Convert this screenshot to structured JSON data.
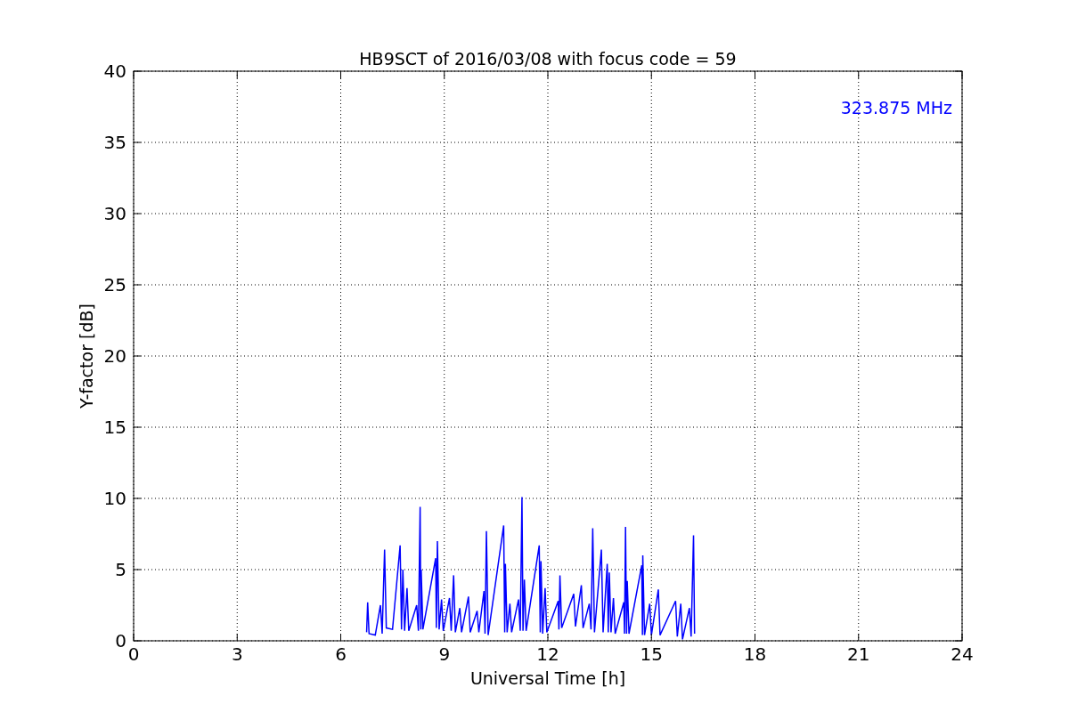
{
  "chart_data": {
    "type": "line",
    "title": "HB9SCT of 2016/03/08 with focus code = 59",
    "xlabel": "Universal Time [h]",
    "ylabel": "Y-factor [dB]",
    "x": [
      6.75,
      6.78,
      6.82,
      7.0,
      7.15,
      7.2,
      7.27,
      7.32,
      7.5,
      7.72,
      7.76,
      7.8,
      7.85,
      7.92,
      7.97,
      8.2,
      8.25,
      8.3,
      8.32,
      8.33,
      8.38,
      8.75,
      8.77,
      8.8,
      8.85,
      8.92,
      8.97,
      9.15,
      9.2,
      9.27,
      9.32,
      9.45,
      9.5,
      9.7,
      9.75,
      9.95,
      10.0,
      10.15,
      10.18,
      10.22,
      10.27,
      10.72,
      10.75,
      10.77,
      10.82,
      10.9,
      10.95,
      11.15,
      11.2,
      11.25,
      11.28,
      11.32,
      11.37,
      11.75,
      11.78,
      11.8,
      11.85,
      11.92,
      11.97,
      12.3,
      12.32,
      12.35,
      12.4,
      12.75,
      12.8,
      12.97,
      13.02,
      13.2,
      13.25,
      13.3,
      13.35,
      13.55,
      13.6,
      13.72,
      13.75,
      13.78,
      13.83,
      13.9,
      13.95,
      14.2,
      14.22,
      14.25,
      14.28,
      14.3,
      14.35,
      14.72,
      14.74,
      14.75,
      14.8,
      14.95,
      15.0,
      15.2,
      15.25,
      15.7,
      15.75,
      15.85,
      15.9,
      16.1,
      16.15,
      16.22,
      16.25
    ],
    "series": [
      {
        "name": "323.875 MHz",
        "color": "#0000ff",
        "values": [
          0.6,
          2.7,
          0.5,
          0.4,
          2.5,
          0.5,
          6.4,
          0.9,
          0.8,
          6.7,
          0.8,
          5,
          0.7,
          3.7,
          0.7,
          2.5,
          0.7,
          9.4,
          0.8,
          5,
          0.8,
          5.8,
          0.9,
          7,
          0.8,
          2.9,
          0.7,
          3,
          0.7,
          4.6,
          0.6,
          2.3,
          0.6,
          3.1,
          0.6,
          2.1,
          0.6,
          3.5,
          0.5,
          7.7,
          0.4,
          8.1,
          0.6,
          5.4,
          0.6,
          2.6,
          0.6,
          2.9,
          0.7,
          10.1,
          0.7,
          4.3,
          0.7,
          6.7,
          0.6,
          5.6,
          0.5,
          3.7,
          0.6,
          2.8,
          0.8,
          4.6,
          0.9,
          3.3,
          1.0,
          3.9,
          0.9,
          2.6,
          0.8,
          7.9,
          0.6,
          6.4,
          0.6,
          5.4,
          0.6,
          4.8,
          0.6,
          3.0,
          0.5,
          2.7,
          0.5,
          8,
          0.5,
          4.2,
          0.5,
          5.3,
          0.4,
          6,
          0.4,
          2.6,
          0.4,
          3.6,
          0.4,
          2.8,
          0.3,
          2.6,
          0.1,
          2.3,
          0.3,
          7.4,
          0.5
        ]
      }
    ],
    "grid": true,
    "xlim": [
      0,
      24
    ],
    "ylim": [
      0,
      40
    ],
    "xticks": [
      0,
      3,
      6,
      9,
      12,
      15,
      18,
      21,
      24
    ],
    "yticks": [
      0,
      5,
      10,
      15,
      20,
      25,
      30,
      35,
      40
    ]
  }
}
